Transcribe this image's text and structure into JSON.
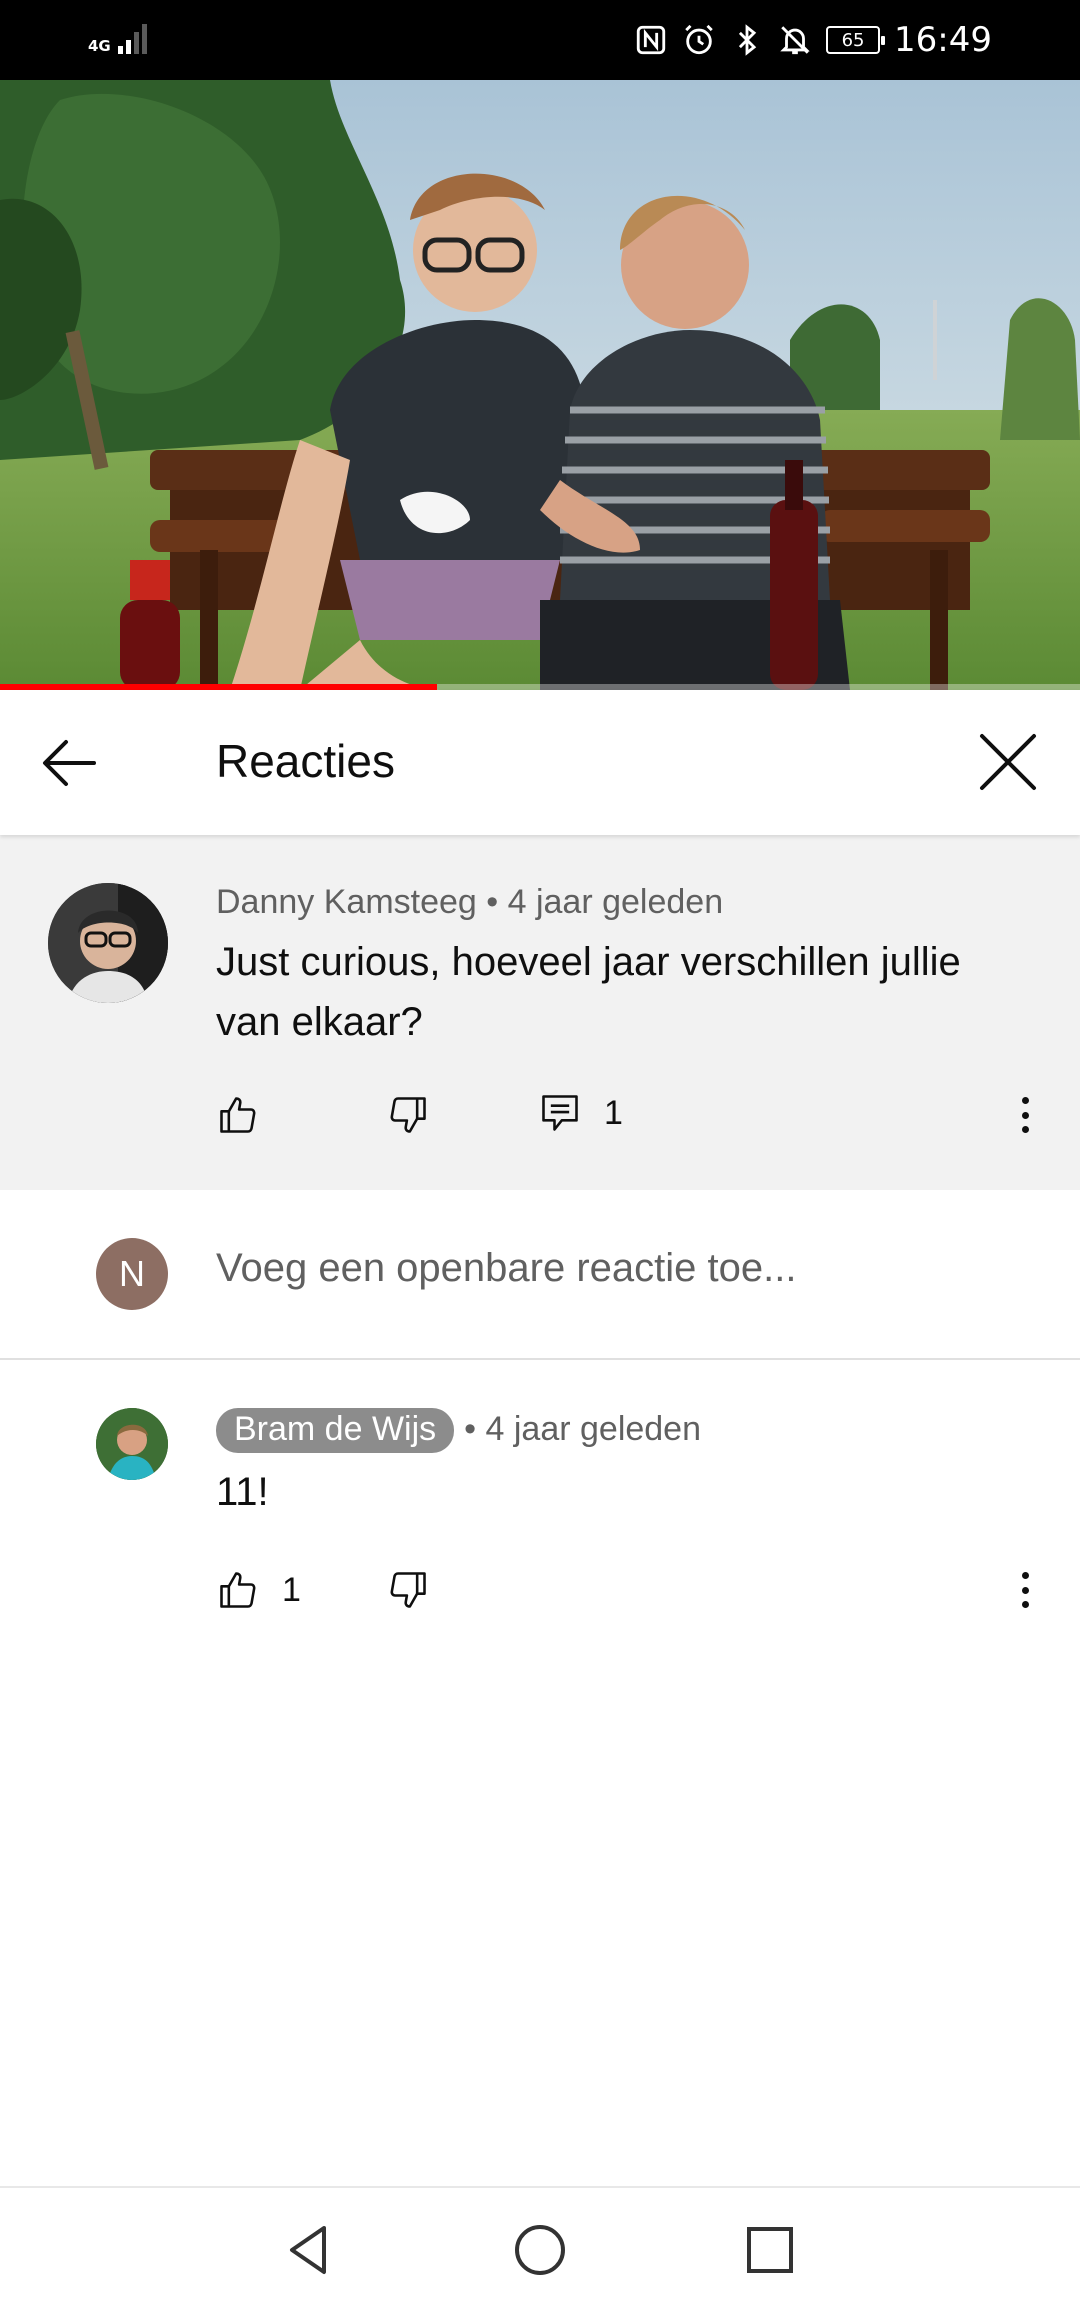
{
  "status_bar": {
    "network": "4G",
    "battery": "65",
    "time": "16:49"
  },
  "video": {
    "progress": 0.405
  },
  "panel": {
    "title": "Reacties"
  },
  "parent_comment": {
    "author": "Danny Kamsteeg",
    "separator": " • ",
    "age": "4 jaar geleden",
    "text": "Just curious, hoeveel jaar verschillen jullie van elkaar?",
    "reply_count": "1"
  },
  "add_reply": {
    "avatar_letter": "N",
    "placeholder": "Voeg een openbare reactie toe..."
  },
  "replies": [
    {
      "author": "Bram de Wijs",
      "separator": "• ",
      "age": "4 jaar geleden",
      "text": "11!",
      "like_count": "1"
    }
  ]
}
